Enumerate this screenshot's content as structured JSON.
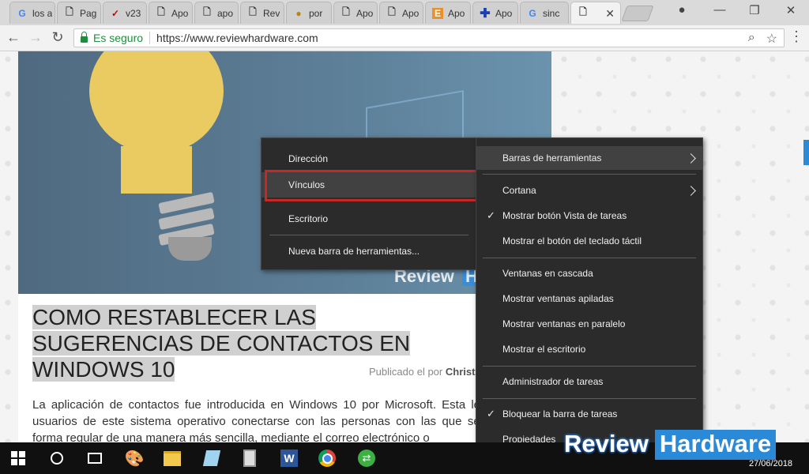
{
  "browser": {
    "tabs": [
      {
        "icon": "google-icon",
        "title": "los a"
      },
      {
        "icon": "page-icon",
        "title": "Pag"
      },
      {
        "icon": "check-icon",
        "title": "v23"
      },
      {
        "icon": "page-icon",
        "title": "Apo"
      },
      {
        "icon": "page-icon",
        "title": "apo"
      },
      {
        "icon": "page-icon",
        "title": "Rev"
      },
      {
        "icon": "globe-icon",
        "title": "por"
      },
      {
        "icon": "page-icon",
        "title": "Apo"
      },
      {
        "icon": "page-icon",
        "title": "Apo"
      },
      {
        "icon": "e-icon",
        "title": "Apo"
      },
      {
        "icon": "cross-icon",
        "title": "Apo"
      },
      {
        "icon": "google-icon",
        "title": "sinc"
      },
      {
        "icon": "page-icon",
        "title": "",
        "active": true
      }
    ],
    "tab_close_glyph": "✕",
    "security_label": "Es seguro",
    "url": "https://www.reviewhardware.com",
    "window_controls": {
      "user": "●",
      "minimize": "—",
      "restore": "❐",
      "close": "✕"
    }
  },
  "article": {
    "hero_brand_left": "Review",
    "hero_brand_right": "H",
    "title": "COMO RESTABLECER LAS SUGERENCIAS DE CONTACTOS EN WINDOWS 10",
    "byline_prefix": "Publicado el por",
    "byline_author": "Christ",
    "body": "La aplicación de contactos fue introducida en Windows 10 por Microsoft. Esta les p usuarios de este sistema operativo conectarse con las personas con las que se co forma regular de una manera más sencilla, mediante el correo electrónico o"
  },
  "submenu": {
    "items": [
      {
        "label": "Dirección"
      },
      {
        "label": "Vínculos",
        "highlighted": true
      },
      {
        "label": "Escritorio"
      },
      {
        "label": "Nueva barra de herramientas..."
      }
    ]
  },
  "taskbar_menu": {
    "items": [
      {
        "label": "Barras de herramientas",
        "submenu": true,
        "hover": true
      },
      {
        "label": "Cortana",
        "submenu": true
      },
      {
        "label": "Mostrar botón Vista de tareas",
        "checked": true
      },
      {
        "label": "Mostrar el botón del teclado táctil"
      },
      {
        "label": "Ventanas en cascada"
      },
      {
        "label": "Mostrar ventanas apiladas"
      },
      {
        "label": "Mostrar ventanas en paralelo"
      },
      {
        "label": "Mostrar el escritorio"
      },
      {
        "label": "Administrador de tareas"
      },
      {
        "label": "Bloquear la barra de tareas",
        "checked": true
      },
      {
        "label": "Propiedades"
      }
    ],
    "check_glyph": "✓"
  },
  "watermark": {
    "left": "Review",
    "right": "Hardware"
  },
  "taskbar": {
    "apps": [
      "start-icon",
      "cortana-icon",
      "task-view-icon",
      "paint-icon",
      "file-explorer-icon",
      "notes-icon",
      "calculator-icon",
      "word-icon",
      "chrome-icon",
      "transfer-icon"
    ],
    "date": "27/06/2018"
  },
  "colors": {
    "menu_bg": "#2b2b2b",
    "highlight_border": "#c62828",
    "brand_blue": "#2a8ad8",
    "secure_green": "#1e8e3e"
  }
}
